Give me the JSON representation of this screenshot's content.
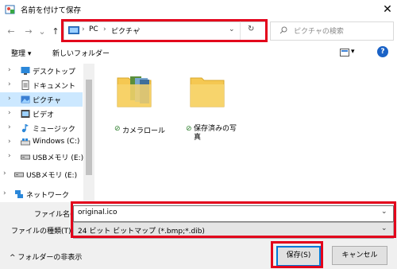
{
  "window": {
    "title": "名前を付けて保存",
    "close": "✕"
  },
  "nav": {
    "back": "←",
    "forward": "→",
    "recent": "⌄",
    "up": "↑"
  },
  "address": {
    "crumbs": [
      "PC",
      "ピクチャ"
    ],
    "separator": "›",
    "dropdown": "⌄",
    "refresh": "↻"
  },
  "search": {
    "placeholder": "ピクチャの検索",
    "icon": "search-icon"
  },
  "toolbar": {
    "organize": "整理 ▾",
    "new_folder": "新しいフォルダー",
    "view": "▾",
    "help": "?"
  },
  "sidebar": {
    "items": [
      {
        "label": "デスクトップ",
        "chev": "›",
        "icon": "desktop-icon"
      },
      {
        "label": "ドキュメント",
        "chev": "›",
        "icon": "document-icon"
      },
      {
        "label": "ピクチャ",
        "chev": "›",
        "icon": "picture-icon",
        "selected": true
      },
      {
        "label": "ビデオ",
        "chev": "›",
        "icon": "video-icon"
      },
      {
        "label": "ミュージック",
        "chev": "›",
        "icon": "music-icon"
      },
      {
        "label": "Windows (C:)",
        "chev": "›",
        "icon": "drive-icon"
      },
      {
        "label": "USBメモリ (E:)",
        "chev": "›",
        "icon": "usb-drive-icon"
      },
      {
        "label": "USBメモリ (E:)",
        "chev": "›",
        "icon": "usb-drive-icon"
      },
      {
        "label": "ネットワーク",
        "chev": "›",
        "icon": "network-icon"
      }
    ]
  },
  "folders": [
    {
      "label": "カメラロール",
      "check": "⊘"
    },
    {
      "label": "保存済みの写\n真",
      "check": "⊘"
    }
  ],
  "form": {
    "filename_label": "ファイル名(N):",
    "filename_value": "original.ico",
    "filetype_label": "ファイルの種類(T):",
    "filetype_value": "24 ビット ビットマップ (*.bmp;*.dib)"
  },
  "footer": {
    "hide_folders": "^ フォルダーの非表示",
    "save": "保存(S)",
    "cancel": "キャンセル"
  },
  "colors": {
    "highlight": "#e3001b",
    "selection": "#cce8ff",
    "accent": "#0078d7",
    "folder": "#f5c852"
  }
}
